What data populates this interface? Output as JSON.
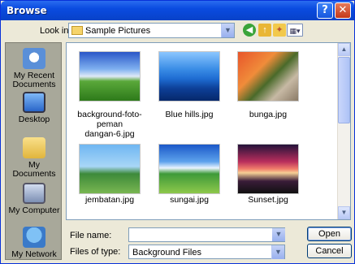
{
  "window": {
    "title": "Browse"
  },
  "titlebar_buttons": {
    "help": "?",
    "close": "✕"
  },
  "toolbar": {
    "look_in_label": "Look in:",
    "look_in_value": "Sample Pictures"
  },
  "places": [
    {
      "label_line1": "My Recent",
      "label_line2": "Documents",
      "icon": "recent-documents-icon"
    },
    {
      "label_line1": "Desktop",
      "label_line2": "",
      "icon": "desktop-icon"
    },
    {
      "label_line1": "My Documents",
      "label_line2": "",
      "icon": "my-documents-icon"
    },
    {
      "label_line1": "My Computer",
      "label_line2": "",
      "icon": "my-computer-icon"
    },
    {
      "label_line1": "My Network",
      "label_line2": "",
      "icon": "my-network-icon"
    }
  ],
  "files": [
    {
      "name_line1": "background-foto-peman",
      "name_line2": "dangan-6.jpg"
    },
    {
      "name_line1": "Blue hills.jpg",
      "name_line2": ""
    },
    {
      "name_line1": "bunga.jpg",
      "name_line2": ""
    },
    {
      "name_line1": "jembatan.jpg",
      "name_line2": ""
    },
    {
      "name_line1": "sungai.jpg",
      "name_line2": ""
    },
    {
      "name_line1": "Sunset.jpg",
      "name_line2": ""
    }
  ],
  "form": {
    "file_name_label": "File name:",
    "file_name_value": "",
    "files_of_type_label": "Files of type:",
    "files_of_type_value": "Background Files"
  },
  "buttons": {
    "open": "Open",
    "cancel": "Cancel"
  },
  "colors": {
    "titlebar": "#0a4be0",
    "window_bg": "#ece9d8",
    "places_bg": "#a8a89a"
  }
}
